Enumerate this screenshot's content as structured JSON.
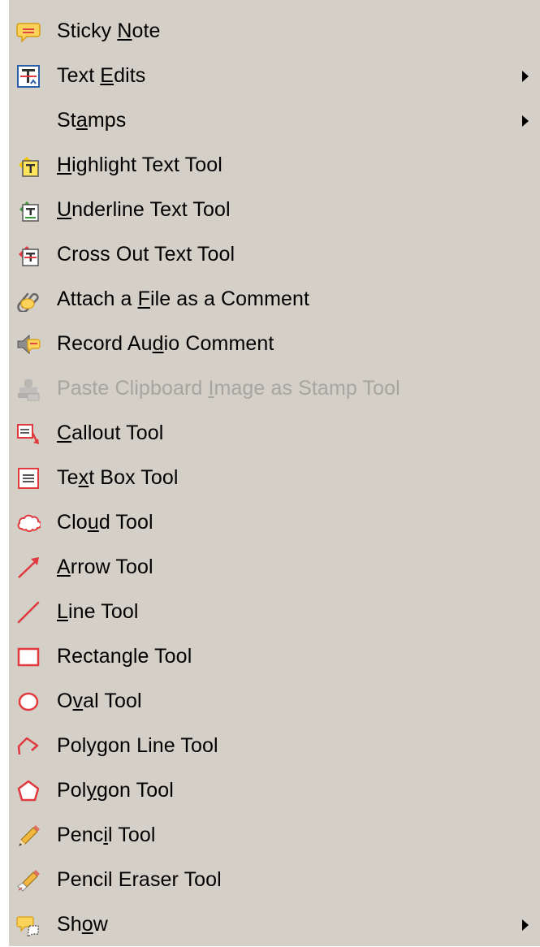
{
  "menu": {
    "items": [
      {
        "pre": "Sticky ",
        "ul": "N",
        "post": "ote",
        "icon": "sticky-note-icon",
        "submenu": false,
        "disabled": false
      },
      {
        "pre": "Text ",
        "ul": "E",
        "post": "dits",
        "icon": "text-edits-icon",
        "submenu": true,
        "disabled": false
      },
      {
        "pre": "St",
        "ul": "a",
        "post": "mps",
        "icon": "",
        "submenu": true,
        "disabled": false
      },
      {
        "pre": "",
        "ul": "H",
        "post": "ighlight Text Tool",
        "icon": "highlight-text-icon",
        "submenu": false,
        "disabled": false
      },
      {
        "pre": "",
        "ul": "U",
        "post": "nderline Text Tool",
        "icon": "underline-text-icon",
        "submenu": false,
        "disabled": false
      },
      {
        "pre": "Cross Out Text Tool",
        "ul": "",
        "post": "",
        "icon": "cross-out-text-icon",
        "submenu": false,
        "disabled": false
      },
      {
        "pre": "Attach a ",
        "ul": "F",
        "post": "ile as a Comment",
        "icon": "paperclip-icon",
        "submenu": false,
        "disabled": false
      },
      {
        "pre": "Record Au",
        "ul": "d",
        "post": "io Comment",
        "icon": "speaker-icon",
        "submenu": false,
        "disabled": false
      },
      {
        "pre": "Paste Clipboard ",
        "ul": "I",
        "post": "mage as Stamp Tool",
        "icon": "stamp-icon",
        "submenu": false,
        "disabled": true
      },
      {
        "pre": "",
        "ul": "C",
        "post": "allout Tool",
        "icon": "callout-icon",
        "submenu": false,
        "disabled": false
      },
      {
        "pre": "Te",
        "ul": "x",
        "post": "t Box Tool",
        "icon": "text-box-icon",
        "submenu": false,
        "disabled": false
      },
      {
        "pre": "Clo",
        "ul": "u",
        "post": "d Tool",
        "icon": "cloud-icon",
        "submenu": false,
        "disabled": false
      },
      {
        "pre": "",
        "ul": "A",
        "post": "rrow Tool",
        "icon": "arrow-icon",
        "submenu": false,
        "disabled": false
      },
      {
        "pre": "",
        "ul": "L",
        "post": "ine Tool",
        "icon": "line-icon",
        "submenu": false,
        "disabled": false
      },
      {
        "pre": "Rectan",
        "ul": "g",
        "post": "le Tool",
        "icon": "rectangle-icon",
        "submenu": false,
        "disabled": false
      },
      {
        "pre": "O",
        "ul": "v",
        "post": "al Tool",
        "icon": "oval-icon",
        "submenu": false,
        "disabled": false
      },
      {
        "pre": "Polygon Line Tool",
        "ul": "",
        "post": "",
        "icon": "polygon-line-icon",
        "submenu": false,
        "disabled": false
      },
      {
        "pre": "Pol",
        "ul": "y",
        "post": "gon Tool",
        "icon": "polygon-icon",
        "submenu": false,
        "disabled": false
      },
      {
        "pre": "Penc",
        "ul": "i",
        "post": "l Tool",
        "icon": "pencil-icon",
        "submenu": false,
        "disabled": false
      },
      {
        "pre": "Pencil Eraser Tool",
        "ul": "",
        "post": "",
        "icon": "pencil-eraser-icon",
        "submenu": false,
        "disabled": false
      },
      {
        "pre": "Sh",
        "ul": "o",
        "post": "w",
        "icon": "show-comments-icon",
        "submenu": true,
        "disabled": false
      }
    ]
  },
  "colors": {
    "menu_background": "#d4d0c8",
    "disabled_text": "#a7a59f",
    "annotation_red": "#e0393e"
  }
}
